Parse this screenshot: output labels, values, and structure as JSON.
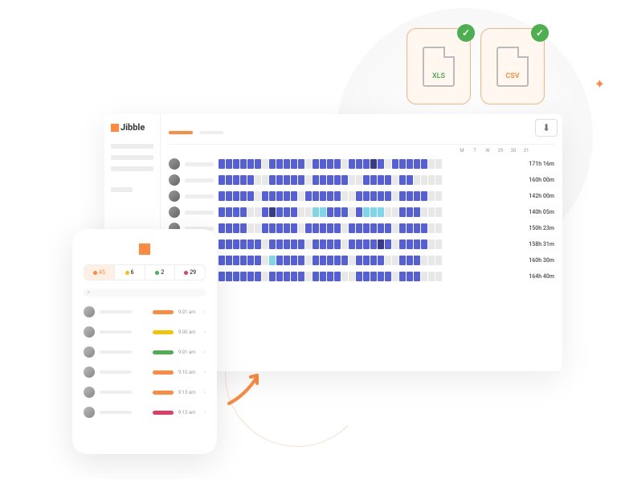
{
  "brand": "Jibble",
  "export": {
    "xls": "XLS",
    "csv": "CSV"
  },
  "dashboard": {
    "dayLabels": [
      "M",
      "T",
      "W",
      "29",
      "30",
      "31"
    ],
    "rows": [
      {
        "total": "171h 16m",
        "p": "ffffffgfffffgffffgfffdfgfffffgg"
      },
      {
        "total": "160h 00m",
        "p": "fffffggfffffgfffffggffffgffgggg"
      },
      {
        "total": "142h 00m",
        "p": "fffffgfffffgfffffggfffffgffffgg"
      },
      {
        "total": "140h 05m",
        "p": "ffffggfdfffggccfffgfcccggfffggg"
      },
      {
        "total": "150h 23m",
        "p": "ffffggfffffgfffffgffffffgffffgg"
      },
      {
        "total": "158h 31m",
        "p": "ffffffgfffffgffffgffffdfgffffgg"
      },
      {
        "total": "160h 30m",
        "p": "ffffffgcffffgfffffgffffggfffggg"
      },
      {
        "total": "164h 40m",
        "p": "ffffffgfffffgffffggfffffgfffggg"
      }
    ]
  },
  "phone": {
    "tabs": [
      {
        "count": "45",
        "color": "#ff8a3d",
        "active": true
      },
      {
        "count": "6",
        "color": "#f5c400"
      },
      {
        "count": "2",
        "color": "#4caf50"
      },
      {
        "count": "29",
        "color": "#e63963"
      }
    ],
    "rows": [
      {
        "status": "#ff8a3d",
        "time": "9:01 am"
      },
      {
        "status": "#f5c400",
        "time": "9:00 am"
      },
      {
        "status": "#4caf50",
        "time": "9:01 am"
      },
      {
        "status": "#ff8a3d",
        "time": "9:10 am"
      },
      {
        "status": "#ff8a3d",
        "time": "9:15 am"
      },
      {
        "status": "#e63963",
        "time": "9:13 am"
      }
    ]
  }
}
